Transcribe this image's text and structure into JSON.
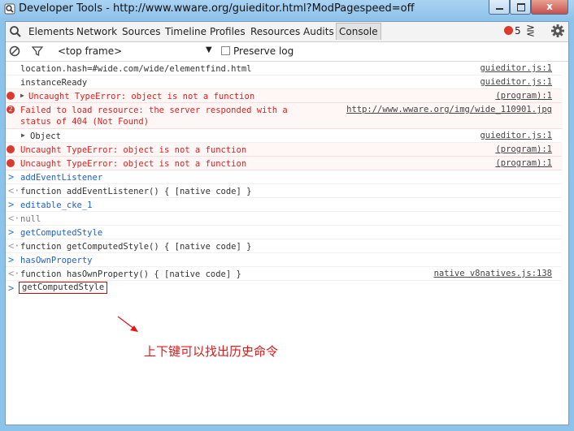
{
  "window": {
    "title": "Developer Tools - http://www.wware.org/guieditor.html?ModPagespeed=off",
    "close_glyph": "x"
  },
  "tabs": [
    {
      "label": "Elements"
    },
    {
      "label": "Network"
    },
    {
      "label": "Sources"
    },
    {
      "label": "Timeline"
    },
    {
      "label": "Profiles"
    },
    {
      "label": "Resources"
    },
    {
      "label": "Audits"
    },
    {
      "label": "Console"
    }
  ],
  "error_count": "5",
  "drawer_glyph": "⋛",
  "filter": {
    "frame": "<top frame>",
    "caret": "▼",
    "preserve_log": "Preserve log",
    "preserve_log_checked": false
  },
  "console": {
    "lines": [
      {
        "kind": "log",
        "text": "location.hash=#wide.com/wide/elementfind.html",
        "source": "guieditor.js:1"
      },
      {
        "kind": "log",
        "text": "instanceReady",
        "source": "guieditor.js:1"
      },
      {
        "kind": "error",
        "text": "Uncaught TypeError: object is not a function",
        "source": "(program):1",
        "expandable": true
      },
      {
        "kind": "error",
        "text": "Failed to load resource: the server responded with a\nstatus of 404 (Not Found)",
        "source": "http://www.wware.org/img/wide_110901.jpg",
        "badge": "2"
      },
      {
        "kind": "log",
        "text": "Object",
        "source": "guieditor.js:1",
        "expandable": true
      },
      {
        "kind": "error",
        "text": "Uncaught TypeError: object is not a function",
        "source": "(program):1"
      },
      {
        "kind": "error",
        "text": "Uncaught TypeError: object is not a function",
        "source": "(program):1"
      },
      {
        "kind": "command",
        "text": "addEventListener"
      },
      {
        "kind": "result",
        "text": "function addEventListener() { [native code] }"
      },
      {
        "kind": "command",
        "text": "editable_cke_1"
      },
      {
        "kind": "result",
        "text": "null",
        "gray": true
      },
      {
        "kind": "command",
        "text": "getComputedStyle"
      },
      {
        "kind": "result",
        "text": "function getComputedStyle() { [native code] }"
      },
      {
        "kind": "command",
        "text": "hasOwnProperty"
      },
      {
        "kind": "result",
        "text": "function hasOwnProperty() { [native code] }",
        "source": "native v8natives.js:138"
      }
    ],
    "prompt_glyph": ">",
    "result_glyph": "<·",
    "input_value": "getComputedStyle"
  },
  "annotation": "上下键可以找出历史命令",
  "colors": {
    "error_red": "#d93b30",
    "command_blue": "#2060c8",
    "annotation_red": "#e01818"
  }
}
